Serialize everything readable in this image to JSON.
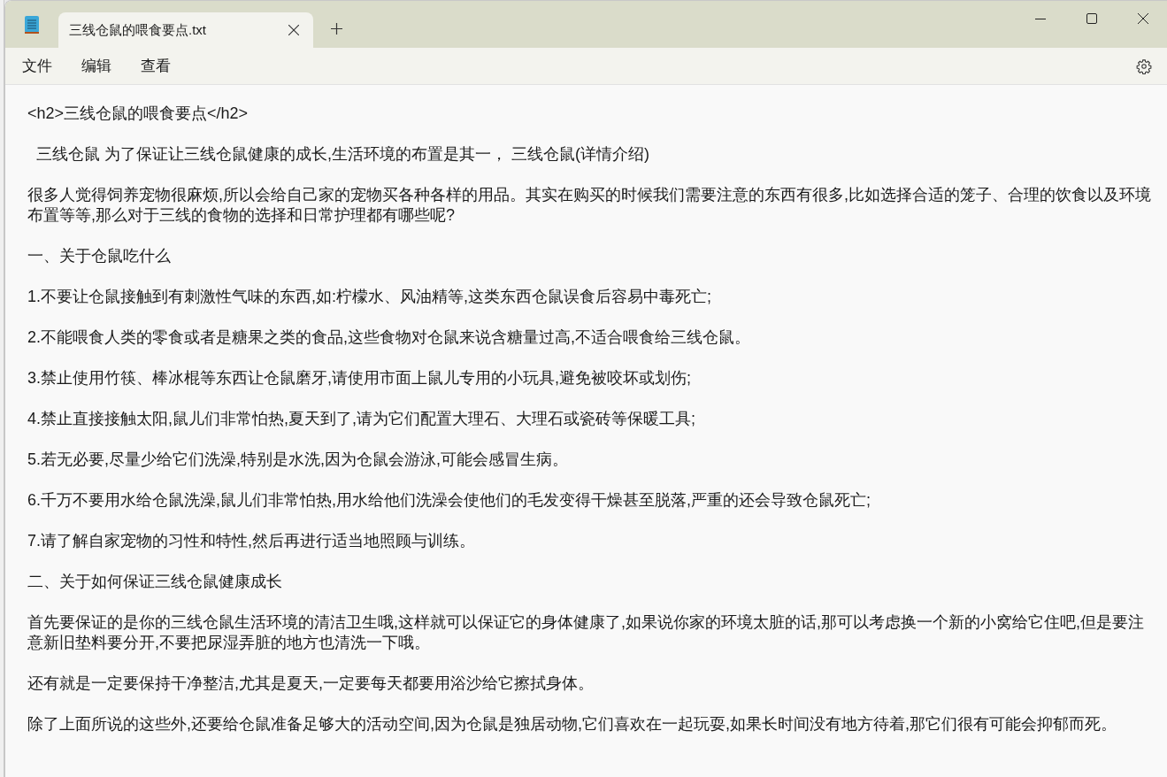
{
  "tabs": [
    {
      "label": "三线仓鼠的喂食要点.txt",
      "selected": true
    }
  ],
  "menu": [
    "文件",
    "编辑",
    "查看"
  ],
  "paragraphs": [
    "<h2>三线仓鼠的喂食要点</h2>",
    "  三线仓鼠 为了保证让三线仓鼠健康的成长,生活环境的布置是其一， 三线仓鼠(详情介绍)",
    "很多人觉得饲养宠物很麻烦,所以会给自己家的宠物买各种各样的用品。其实在购买的时候我们需要注意的东西有很多,比如选择合适的笼子、合理的饮食以及环境布置等等,那么对于三线的食物的选择和日常护理都有哪些呢?",
    "一、关于仓鼠吃什么",
    "1.不要让仓鼠接触到有刺激性气味的东西,如:柠檬水、风油精等,这类东西仓鼠误食后容易中毒死亡;",
    "2.不能喂食人类的零食或者是糖果之类的食品,这些食物对仓鼠来说含糖量过高,不适合喂食给三线仓鼠。",
    "3.禁止使用竹筷、棒冰棍等东西让仓鼠磨牙,请使用市面上鼠儿专用的小玩具,避免被咬坏或划伤;",
    "4.禁止直接接触太阳,鼠儿们非常怕热,夏天到了,请为它们配置大理石、大理石或瓷砖等保暖工具;",
    "5.若无必要,尽量少给它们洗澡,特别是水洗,因为仓鼠会游泳,可能会感冒生病。",
    "6.千万不要用水给仓鼠洗澡,鼠儿们非常怕热,用水给他们洗澡会使他们的毛发变得干燥甚至脱落,严重的还会导致仓鼠死亡;",
    "7.请了解自家宠物的习性和特性,然后再进行适当地照顾与训练。",
    "二、关于如何保证三线仓鼠健康成长",
    "首先要保证的是你的三线仓鼠生活环境的清洁卫生哦,这样就可以保证它的身体健康了,如果说你家的环境太脏的话,那可以考虑换一个新的小窝给它住吧,但是要注意新旧垫料要分开,不要把尿湿弄脏的地方也清洗一下哦。",
    "还有就是一定要保持干净整洁,尤其是夏天,一定要每天都要用浴沙给它擦拭身体。",
    "除了上面所说的这些外,还要给仓鼠准备足够大的活动空间,因为仓鼠是独居动物,它们喜欢在一起玩耍,如果长时间没有地方待着,那它们很有可能会抑郁而死。"
  ]
}
